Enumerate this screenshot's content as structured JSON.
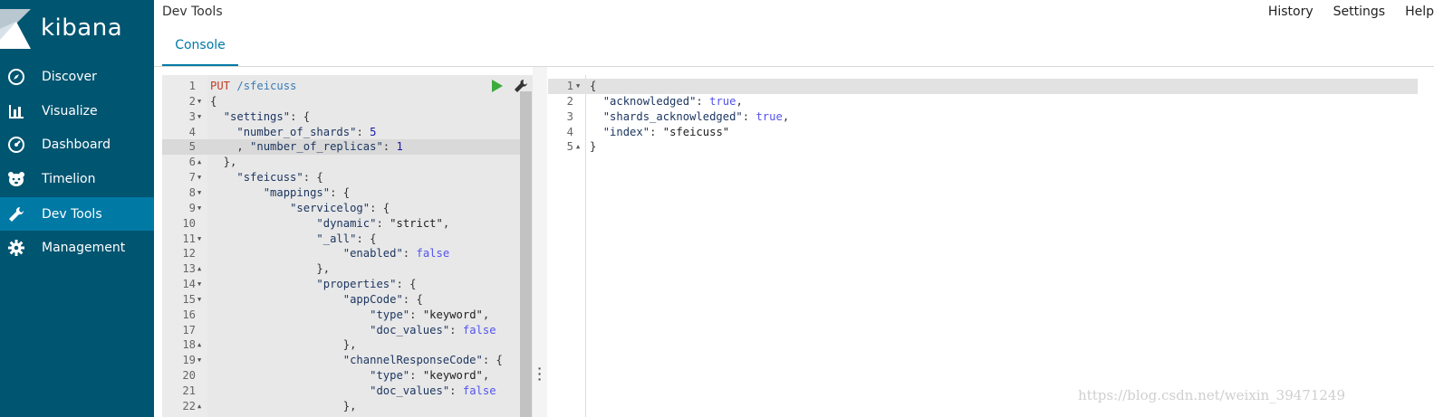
{
  "brand": {
    "name": "kibana"
  },
  "sidebar": {
    "items": [
      {
        "label": "Discover",
        "icon": "compass-icon"
      },
      {
        "label": "Visualize",
        "icon": "bar-chart-icon"
      },
      {
        "label": "Dashboard",
        "icon": "dashboard-gauge-icon"
      },
      {
        "label": "Timelion",
        "icon": "timelion-bear-icon"
      },
      {
        "label": "Dev Tools",
        "icon": "wrench-icon",
        "active": true
      },
      {
        "label": "Management",
        "icon": "gear-icon"
      }
    ]
  },
  "header": {
    "title": "Dev Tools",
    "links": [
      "History",
      "Settings",
      "Help"
    ],
    "tabs": [
      {
        "label": "Console",
        "active": true
      }
    ]
  },
  "editor": {
    "lines": [
      {
        "n": "1",
        "fold": "",
        "text": "PUT /sfeicuss"
      },
      {
        "n": "2",
        "fold": "▼",
        "text": "{"
      },
      {
        "n": "3",
        "fold": "▼",
        "text": "  \"settings\": {"
      },
      {
        "n": "4",
        "fold": "",
        "text": "    \"number_of_shards\": 5"
      },
      {
        "n": "5",
        "fold": "",
        "text": "    , \"number_of_replicas\": 1",
        "highlight": true
      },
      {
        "n": "6",
        "fold": "▲",
        "text": "  },"
      },
      {
        "n": "7",
        "fold": "▼",
        "text": "    \"sfeicuss\": {"
      },
      {
        "n": "8",
        "fold": "▼",
        "text": "        \"mappings\": {"
      },
      {
        "n": "9",
        "fold": "▼",
        "text": "            \"servicelog\": {"
      },
      {
        "n": "10",
        "fold": "",
        "text": "                \"dynamic\": \"strict\","
      },
      {
        "n": "11",
        "fold": "▼",
        "text": "                \"_all\": {"
      },
      {
        "n": "12",
        "fold": "",
        "text": "                    \"enabled\": false"
      },
      {
        "n": "13",
        "fold": "▲",
        "text": "                },"
      },
      {
        "n": "14",
        "fold": "▼",
        "text": "                \"properties\": {"
      },
      {
        "n": "15",
        "fold": "▼",
        "text": "                    \"appCode\": {"
      },
      {
        "n": "16",
        "fold": "",
        "text": "                        \"type\": \"keyword\","
      },
      {
        "n": "17",
        "fold": "",
        "text": "                        \"doc_values\": false"
      },
      {
        "n": "18",
        "fold": "▲",
        "text": "                    },"
      },
      {
        "n": "19",
        "fold": "▼",
        "text": "                    \"channelResponseCode\": {"
      },
      {
        "n": "20",
        "fold": "",
        "text": "                        \"type\": \"keyword\","
      },
      {
        "n": "21",
        "fold": "",
        "text": "                        \"doc_values\": false"
      },
      {
        "n": "22",
        "fold": "▲",
        "text": "                    },"
      }
    ]
  },
  "output": {
    "lines": [
      {
        "n": "1",
        "fold": "▼",
        "text": "{",
        "highlight": true
      },
      {
        "n": "2",
        "fold": "",
        "text": "  \"acknowledged\": true,"
      },
      {
        "n": "3",
        "fold": "",
        "text": "  \"shards_acknowledged\": true,"
      },
      {
        "n": "4",
        "fold": "",
        "text": "  \"index\": \"sfeicuss\""
      },
      {
        "n": "5",
        "fold": "▲",
        "text": "}"
      }
    ]
  },
  "watermark": "https://blog.csdn.net/weixin_39471249",
  "colors": {
    "sidebar": "#005571",
    "active": "#0079a5",
    "accent": "#0079a5"
  }
}
